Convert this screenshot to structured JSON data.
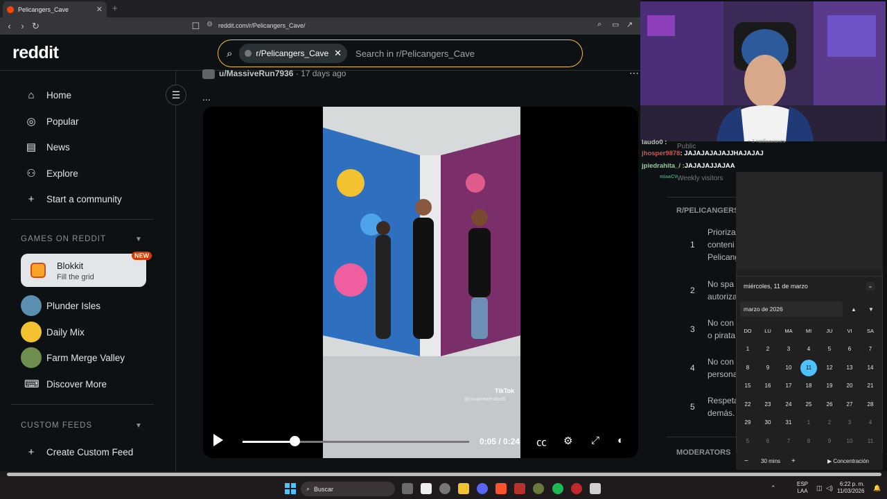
{
  "browser": {
    "tab_title": "Pelicangers_Cave",
    "new_tab": "+",
    "url": "reddit.com/r/Pelicangers_Cave/"
  },
  "header": {
    "logo": "reddit",
    "search_chip": "r/Pelicangers_Cave",
    "search_placeholder": "Search in r/Pelicangers_Cave"
  },
  "sidebar": {
    "nav": [
      {
        "label": "Home"
      },
      {
        "label": "Popular"
      },
      {
        "label": "News"
      },
      {
        "label": "Explore"
      },
      {
        "label": "Start a community"
      }
    ],
    "games_header": "GAMES ON REDDIT",
    "blokkit": {
      "title": "Blokkit",
      "subtitle": "Fill the grid",
      "badge": "NEW"
    },
    "games": [
      {
        "label": "Plunder Isles",
        "color": "#5a8fb0"
      },
      {
        "label": "Daily Mix",
        "color": "#f2c230"
      },
      {
        "label": "Farm Merge Valley",
        "color": "#6e8f4e"
      },
      {
        "label": "Discover More"
      }
    ],
    "custom_header": "CUSTOM FEEDS",
    "create_feed": "Create Custom Feed"
  },
  "post": {
    "user": "u/MassiveRun7936",
    "age": "17 days ago",
    "dots": "...",
    "video": {
      "current": "0:05",
      "duration": "0:24",
      "progress": 0.23,
      "watermark": "TikTok",
      "watermark_user": "@oscarrewerafoo5"
    }
  },
  "community_sidebar": {
    "public": "Public",
    "weekly": "Weekly visitors",
    "rules_title": "R/PELICANGERS_",
    "rules": [
      {
        "n": "1",
        "lines": [
          "Prioriza",
          "conteni",
          "Pelicang"
        ]
      },
      {
        "n": "2",
        "lines": [
          "No spa",
          "autoriza"
        ]
      },
      {
        "n": "3",
        "lines": [
          "No con",
          "o pirata"
        ]
      },
      {
        "n": "4",
        "lines": [
          "No con",
          "persona"
        ]
      },
      {
        "n": "5",
        "lines": [
          "Respeta",
          "demás."
        ]
      }
    ],
    "moderators": "MODERATORS"
  },
  "chat": [
    {
      "user": "laudo0",
      "msg": ":",
      "color": "#c0c0c0"
    },
    {
      "user": "jhosper9878",
      "msg": ": JAJAJAJAJAJJHAJAJAJ",
      "color": "#d9534f"
    },
    {
      "user": "jpiedrahita_/ :",
      "msg": "JAJAJAJJAJAA",
      "color": "#8fd18f"
    },
    {
      "user": "miaaCV",
      "msg": "",
      "color": "#3c9c6c"
    }
  ],
  "chat_notice": "+ 3 notificaciones",
  "calendar": {
    "date_header": "miércoles, 11 de marzo",
    "month": "marzo de 2026",
    "dow": [
      "DO",
      "LU",
      "MA",
      "MI",
      "JU",
      "VI",
      "SA"
    ],
    "weeks": [
      [
        "1",
        "2",
        "3",
        "4",
        "5",
        "6",
        "7"
      ],
      [
        "8",
        "9",
        "10",
        "11",
        "12",
        "13",
        "14"
      ],
      [
        "15",
        "16",
        "17",
        "18",
        "19",
        "20",
        "21"
      ],
      [
        "22",
        "23",
        "24",
        "25",
        "26",
        "27",
        "28"
      ],
      [
        "29",
        "30",
        "31",
        "1",
        "2",
        "3",
        "4"
      ],
      [
        "5",
        "6",
        "7",
        "8",
        "9",
        "10",
        "11"
      ]
    ],
    "today": "11",
    "focus_minutes": "30 mins",
    "focus_label": "Concentración"
  },
  "taskbar": {
    "search": "Buscar",
    "lang": "ESP",
    "lang2": "LAA",
    "time": "6:22 p. m.",
    "date": "11/03/2026"
  }
}
